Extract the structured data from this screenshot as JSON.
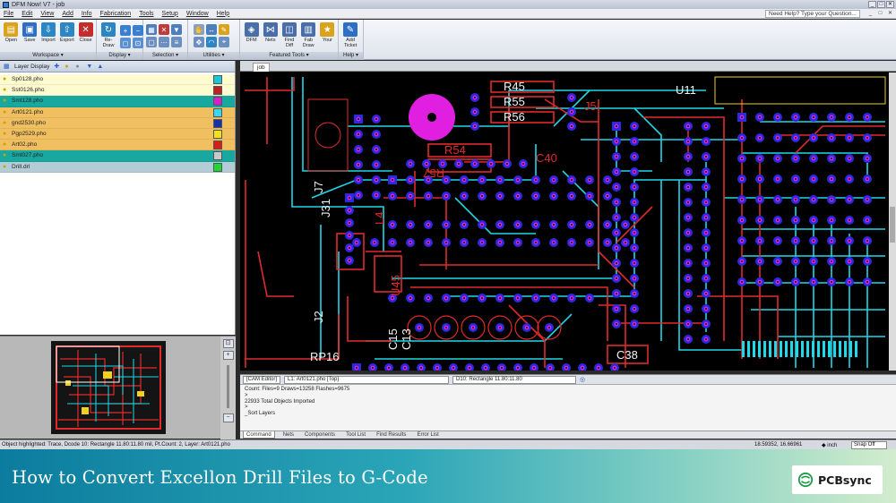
{
  "window": {
    "title": "DFM Now! V7 - job",
    "controls": [
      "_",
      "□",
      "✕"
    ]
  },
  "menubar": {
    "items": [
      "File",
      "Edit",
      "View",
      "Add",
      "Info",
      "Fabrication",
      "Tools",
      "Setup",
      "Window",
      "Help"
    ],
    "help_placeholder": "Need Help? Type your Question..."
  },
  "ribbon": {
    "groups": [
      {
        "name": "Workspace ▾",
        "tools": [
          {
            "label": "Open",
            "icon": "folder-icon",
            "glyph": "▤",
            "color": "#d9a31c"
          },
          {
            "label": "Save",
            "icon": "save-icon",
            "glyph": "▣",
            "color": "#2d6fc4"
          },
          {
            "label": "Import",
            "icon": "import-icon",
            "glyph": "⇩",
            "color": "#2d86c4"
          },
          {
            "label": "Export",
            "icon": "export-icon",
            "glyph": "⇧",
            "color": "#2d86c4"
          },
          {
            "label": "Close",
            "icon": "close-icon",
            "glyph": "✕",
            "color": "#c52c2c"
          }
        ]
      },
      {
        "name": "Display ▾",
        "tools": [
          {
            "label": "Re-Draw",
            "icon": "redraw-icon",
            "glyph": "↻",
            "color": "#2d86c4"
          }
        ]
      },
      {
        "name": "Selection ▾"
      },
      {
        "name": "Utilities ▾"
      },
      {
        "name": "Featured Tools ▾",
        "tools": [
          {
            "label": "DFM",
            "icon": "dfm-icon",
            "glyph": "◈",
            "color": "#4a6ea8"
          },
          {
            "label": "Nets",
            "icon": "nets-icon",
            "glyph": "⋈",
            "color": "#4a6ea8"
          },
          {
            "label": "Find Diff",
            "icon": "find-diff-icon",
            "glyph": "◫",
            "color": "#4a6ea8"
          },
          {
            "label": "Fab Draw",
            "icon": "fab-draw-icon",
            "glyph": "▥",
            "color": "#4a6ea8"
          },
          {
            "label": "Your",
            "icon": "custom-tool-icon",
            "glyph": "★",
            "color": "#d9a31c"
          }
        ]
      },
      {
        "name": "Help ▾",
        "tools": [
          {
            "label": "Add Ticket",
            "icon": "ticket-icon",
            "glyph": "✎",
            "color": "#2d6fc4"
          }
        ]
      }
    ]
  },
  "layer_panel": {
    "title": "Layer Display",
    "layers": [
      {
        "name": "Sp0128.pho",
        "row_color": "#fffbd0",
        "swatch": "#19c7d9"
      },
      {
        "name": "Sst0126.pho",
        "row_color": "#fffbd0",
        "swatch": "#c02020"
      },
      {
        "name": "Smt128.pho",
        "row_color": "#18a8a0",
        "swatch": "#d81fd0"
      },
      {
        "name": "Art0121.pho",
        "row_color": "#f0c060",
        "swatch": "#3ad8f0"
      },
      {
        "name": "gnd2530.pho",
        "row_color": "#f0c060",
        "swatch": "#1b2fa8"
      },
      {
        "name": "Pgp2529.pho",
        "row_color": "#f0c060",
        "swatch": "#f0e020"
      },
      {
        "name": "Art02.pho",
        "row_color": "#f0c060",
        "swatch": "#d81b1b"
      },
      {
        "name": "Smt027.pho",
        "row_color": "#18a8a0",
        "swatch": "#c8c8c8"
      },
      {
        "name": "Drill.drl",
        "row_color": "#b4ccd6",
        "swatch": "#1fd82f"
      }
    ]
  },
  "canvas": {
    "tab": "job",
    "refdes": [
      "R45",
      "R55",
      "R56",
      "R54",
      "R57",
      "U11",
      "J5",
      "J31",
      "J7",
      "J2",
      "C15",
      "C13",
      "RP16",
      "C38",
      "C40",
      "L4",
      "U45"
    ]
  },
  "command": {
    "editor_label": "[CAM Editor]",
    "layer_combo": "L1: Art0121.pho  [Top]",
    "dcode_combo": "D10: Rectangle 11.80:11.80",
    "output": [
      "Count: Files=9 Draws=13258 Flashes=9675",
      ">",
      "22933 Total Objects Imported",
      ">",
      "_Sort Layers"
    ],
    "tabs": [
      "Command",
      "Nets",
      "Components",
      "Tool List",
      "Find Results",
      "Error List"
    ]
  },
  "status": {
    "message": "Object highlighted:   Trace, Dcode 10: Rectangle 11.80:11.80 mil, Pt.Count: 2, Layer: Art0121.pho",
    "coordinates": "18.59352, 16.66961",
    "units": "◆ inch",
    "snap": "Snap Off"
  },
  "banner": {
    "headline": "How to Convert Excellon Drill Files to G-Code",
    "brand": "PCBsync"
  },
  "colors": {
    "trace_cyan": "#1fd8e8",
    "trace_red": "#e02b2b",
    "pad_blue": "#2a2ae0",
    "pad_magenta": "#e01fe0"
  }
}
